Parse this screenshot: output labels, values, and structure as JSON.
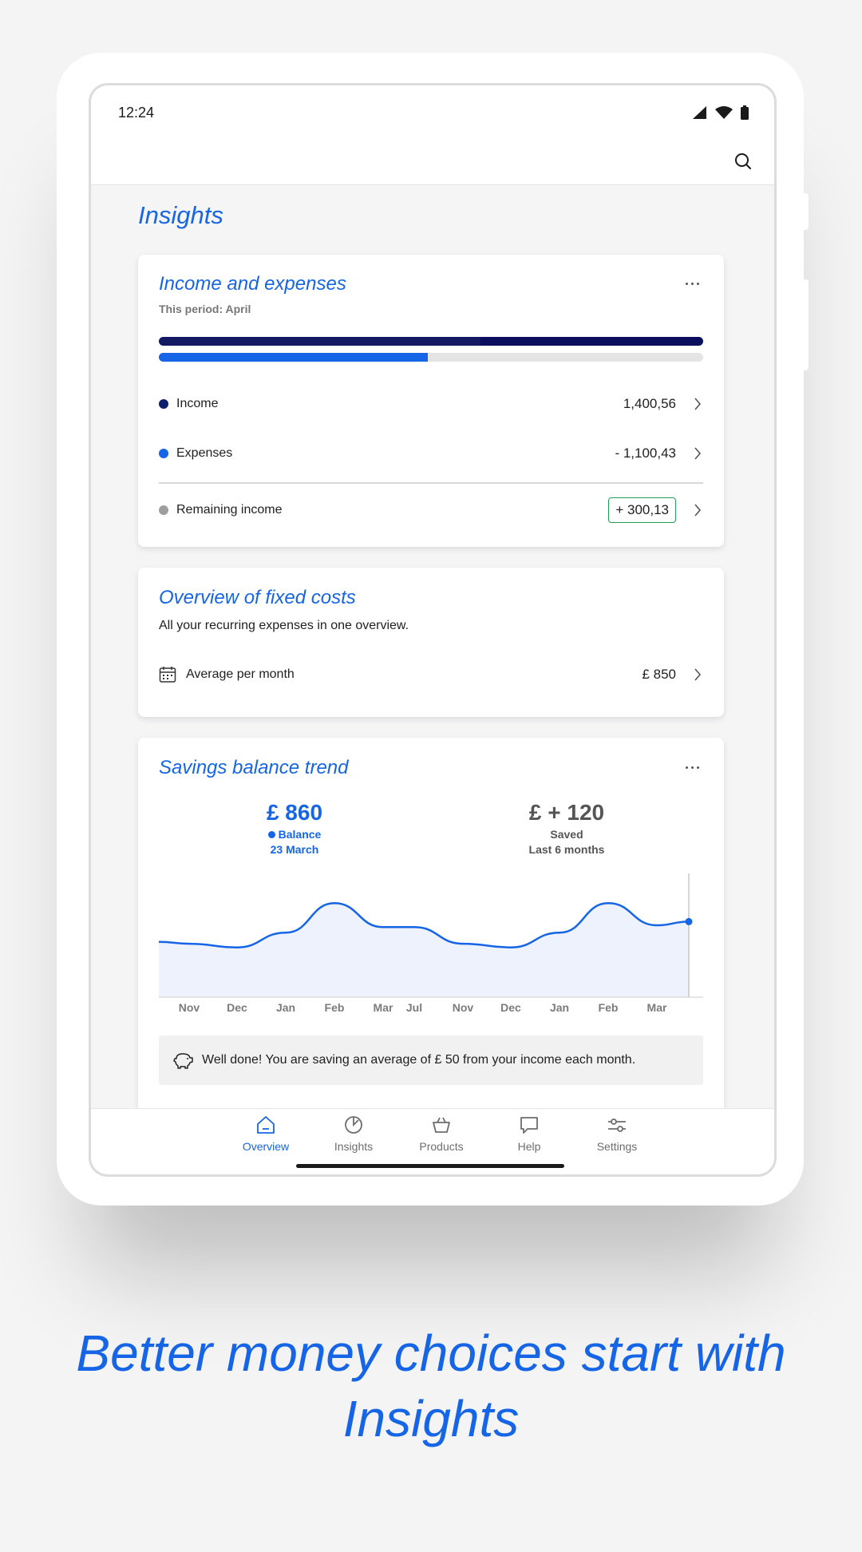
{
  "status_bar": {
    "time": "12:24"
  },
  "page": {
    "title": "Insights"
  },
  "income_card": {
    "title": "Income and expenses",
    "period": "This period: April",
    "income_bar_fraction": 1.0,
    "expenses_bar_fraction": 0.494,
    "rows": [
      {
        "label": "Income",
        "value": "1,400,56",
        "dot_color": "#101f6b"
      },
      {
        "label": "Expenses",
        "value": "- 1,100,43",
        "dot_color": "#1565e6"
      },
      {
        "label": "Remaining income",
        "value": "+ 300,13",
        "dot_color": "#9e9e9e"
      }
    ]
  },
  "fixed_costs_card": {
    "title": "Overview of fixed costs",
    "subtitle": "All your recurring expenses in one overview.",
    "row_label": "Average per month",
    "row_value": "£ 850"
  },
  "savings_card": {
    "title": "Savings balance trend",
    "balance": {
      "value": "£ 860",
      "label": "Balance",
      "date": "23 March"
    },
    "saved": {
      "value": "£ + 120",
      "label": "Saved",
      "period": "Last 6 months"
    },
    "tip": "Well done! You are saving an average of £ 50 from your income each month."
  },
  "chart_data": {
    "type": "area",
    "categories": [
      "Nov",
      "Dec",
      "Jan",
      "Feb",
      "Mar",
      "Jul",
      "Nov",
      "Dec",
      "Jan",
      "Feb",
      "Mar"
    ],
    "series": [
      {
        "name": "Balance",
        "values": [
          640,
          620,
          700,
          860,
          730,
          730,
          640,
          620,
          700,
          860,
          740
        ]
      }
    ],
    "highlight_point_value": 760,
    "ylim": [
      350,
      1000
    ],
    "grid": false,
    "line_color": "#1565e6",
    "fill_color": "#eef2fc"
  },
  "nav": {
    "items": [
      {
        "label": "Overview",
        "icon": "home-icon",
        "active": true
      },
      {
        "label": "Insights",
        "icon": "pie-chart-icon",
        "active": false
      },
      {
        "label": "Products",
        "icon": "basket-icon",
        "active": false
      },
      {
        "label": "Help",
        "icon": "chat-bubble-icon",
        "active": false
      },
      {
        "label": "Settings",
        "icon": "sliders-icon",
        "active": false
      }
    ]
  },
  "headline": {
    "line1": "Better money choices start with",
    "line2": "Insights"
  },
  "colors": {
    "accent": "#1565e6",
    "navy": "#101f6b",
    "positive_border": "#1f9d55"
  }
}
